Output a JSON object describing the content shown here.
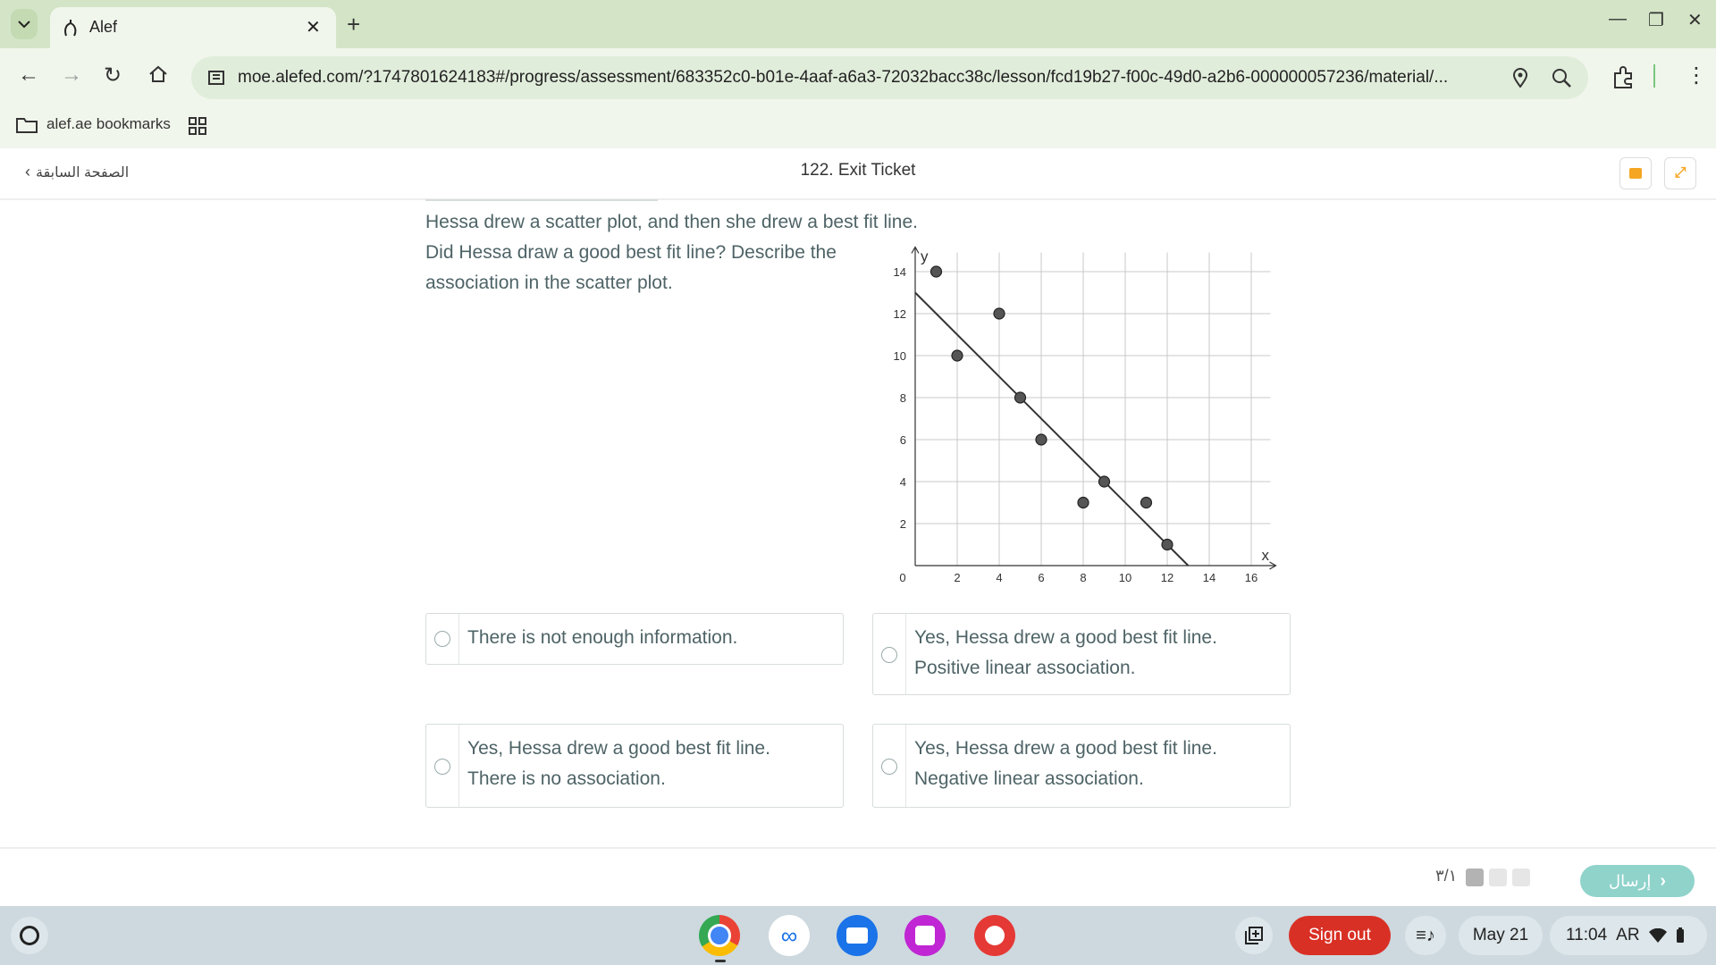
{
  "browser": {
    "tab_title": "Alef",
    "url": "moe.alefed.com/?1747801624183#/progress/assessment/683352c0-b01e-4aaf-a6a3-72032bacc38c/lesson/fcd19b27-f00c-49d0-a2b6-000000057236/material/...",
    "bookmarks_label": "alef.ae bookmarks"
  },
  "header": {
    "back_label": "الصفحة السابقة",
    "title": "122. Exit Ticket"
  },
  "question": {
    "line1": "Hessa drew a scatter plot, and then she drew a best fit line.",
    "line2": "Did Hessa draw a good best fit line? Describe the",
    "line3": "association in the scatter plot."
  },
  "options": [
    {
      "line1": "There is not enough information.",
      "line2": ""
    },
    {
      "line1": "Yes, Hessa drew a good best fit line.",
      "line2": "Positive linear association."
    },
    {
      "line1": "Yes, Hessa drew a good best fit line.",
      "line2": "There is no association."
    },
    {
      "line1": "Yes, Hessa drew a good best fit line.",
      "line2": "Negative linear association."
    }
  ],
  "chart_data": {
    "type": "scatter",
    "xlabel": "x",
    "ylabel": "y",
    "xlim": [
      0,
      17
    ],
    "ylim": [
      0,
      15
    ],
    "xticks": [
      2,
      4,
      6,
      8,
      10,
      12,
      14,
      16
    ],
    "yticks": [
      2,
      4,
      6,
      8,
      10,
      12,
      14
    ],
    "origin_label": "0",
    "grid": true,
    "points": [
      {
        "x": 1,
        "y": 14
      },
      {
        "x": 2,
        "y": 10
      },
      {
        "x": 4,
        "y": 12
      },
      {
        "x": 5,
        "y": 8
      },
      {
        "x": 6,
        "y": 6
      },
      {
        "x": 8,
        "y": 3
      },
      {
        "x": 9,
        "y": 4
      },
      {
        "x": 11,
        "y": 3
      },
      {
        "x": 12,
        "y": 1
      }
    ],
    "best_fit_line": {
      "x1": 0,
      "y1": 13,
      "x2": 13,
      "y2": 0
    }
  },
  "footer": {
    "progress_label": "٣/١",
    "submit_label": "إرسال"
  },
  "shelf": {
    "signout_label": "Sign out",
    "date": "May 21",
    "time": "11:04",
    "ime": "AR"
  },
  "colors": {
    "accent_teal": "#8fd3cb",
    "signout_red": "#d93025",
    "progress_active": "#b3b3b3",
    "progress_inactive": "#e6e6e6"
  }
}
